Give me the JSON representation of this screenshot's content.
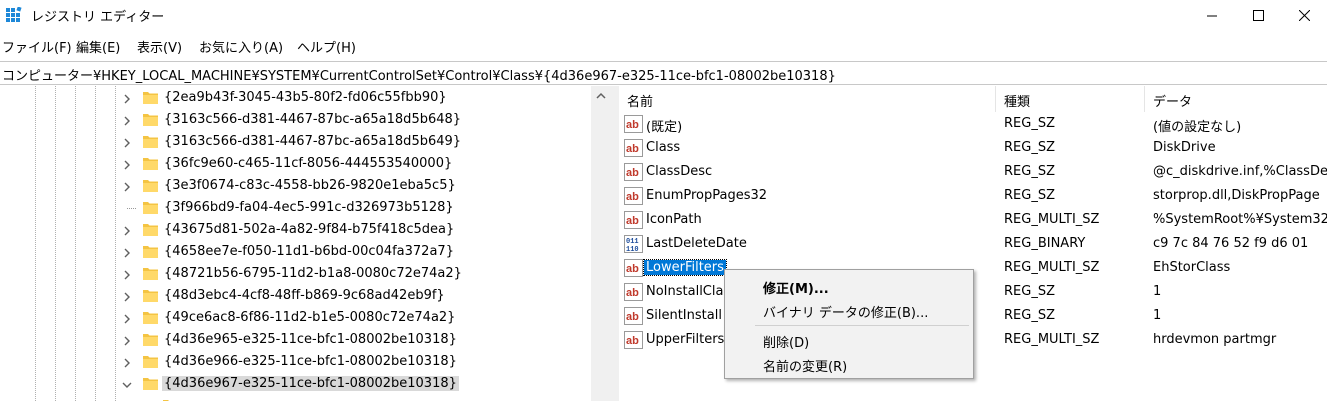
{
  "window": {
    "title": "レジストリ エディター"
  },
  "menu": [
    "ファイル(F)",
    "編集(E)",
    "表示(V)",
    "お気に入り(A)",
    "ヘルプ(H)"
  ],
  "address": "コンピューター¥HKEY_LOCAL_MACHINE¥SYSTEM¥CurrentControlSet¥Control¥Class¥{4d36e967-e325-11ce-bfc1-08002be10318}",
  "tree": {
    "items": [
      {
        "label": "{2ea9b43f-3045-43b5-80f2-fd06c55fbb90}",
        "expandable": true,
        "selected": false
      },
      {
        "label": "{3163c566-d381-4467-87bc-a65a18d5b648}",
        "expandable": true,
        "selected": false
      },
      {
        "label": "{3163c566-d381-4467-87bc-a65a18d5b649}",
        "expandable": true,
        "selected": false
      },
      {
        "label": "{36fc9e60-c465-11cf-8056-444553540000}",
        "expandable": true,
        "selected": false
      },
      {
        "label": "{3e3f0674-c83c-4558-bb26-9820e1eba5c5}",
        "expandable": true,
        "selected": false
      },
      {
        "label": "{3f966bd9-fa04-4ec5-991c-d326973b5128}",
        "expandable": false,
        "selected": false
      },
      {
        "label": "{43675d81-502a-4a82-9f84-b75f418c5dea}",
        "expandable": true,
        "selected": false
      },
      {
        "label": "{4658ee7e-f050-11d1-b6bd-00c04fa372a7}",
        "expandable": true,
        "selected": false
      },
      {
        "label": "{48721b56-6795-11d2-b1a8-0080c72e74a2}",
        "expandable": true,
        "selected": false
      },
      {
        "label": "{48d3ebc4-4cf8-48ff-b869-9c68ad42eb9f}",
        "expandable": true,
        "selected": false
      },
      {
        "label": "{49ce6ac8-6f86-11d2-b1e5-0080c72e74a2}",
        "expandable": true,
        "selected": false
      },
      {
        "label": "{4d36e965-e325-11ce-bfc1-08002be10318}",
        "expandable": true,
        "selected": false
      },
      {
        "label": "{4d36e966-e325-11ce-bfc1-08002be10318}",
        "expandable": true,
        "selected": false
      },
      {
        "label": "{4d36e967-e325-11ce-bfc1-08002be10318}",
        "expandable": true,
        "expanded": true,
        "selected": true
      }
    ]
  },
  "list": {
    "columns": [
      "名前",
      "種類",
      "データ"
    ],
    "rows": [
      {
        "name": "(既定)",
        "type": "REG_SZ",
        "data": "(値の設定なし)",
        "icon": "string-value-icon",
        "selected": false
      },
      {
        "name": "Class",
        "type": "REG_SZ",
        "data": "DiskDrive",
        "icon": "string-value-icon",
        "selected": false
      },
      {
        "name": "ClassDesc",
        "type": "REG_SZ",
        "data": "@c_diskdrive.inf,%ClassDe",
        "icon": "string-value-icon",
        "selected": false
      },
      {
        "name": "EnumPropPages32",
        "type": "REG_SZ",
        "data": "storprop.dll,DiskPropPage",
        "icon": "string-value-icon",
        "selected": false
      },
      {
        "name": "IconPath",
        "type": "REG_MULTI_SZ",
        "data": "%SystemRoot%¥System32",
        "icon": "string-value-icon",
        "selected": false
      },
      {
        "name": "LastDeleteDate",
        "type": "REG_BINARY",
        "data": "c9 7c 84 76 52 f9 d6 01",
        "icon": "binary-value-icon",
        "selected": false
      },
      {
        "name": "LowerFilters",
        "type": "REG_MULTI_SZ",
        "data": "EhStorClass",
        "icon": "string-value-icon",
        "selected": true
      },
      {
        "name": "NoInstallCla",
        "type": "REG_SZ",
        "data": "1",
        "icon": "string-value-icon",
        "selected": false
      },
      {
        "name": "SilentInstall",
        "type": "REG_SZ",
        "data": "1",
        "icon": "string-value-icon",
        "selected": false
      },
      {
        "name": "UpperFilters",
        "type": "REG_MULTI_SZ",
        "data": "hrdevmon partmgr",
        "icon": "string-value-icon",
        "selected": false
      }
    ]
  },
  "context_menu": {
    "modify": "修正(M)...",
    "modify_binary": "バイナリ データの修正(B)...",
    "delete": "削除(D)",
    "rename": "名前の変更(R)"
  },
  "colors": {
    "selection": "#0078d7",
    "folder": "#f4c443",
    "tree_selected": "#d9d9d9"
  }
}
